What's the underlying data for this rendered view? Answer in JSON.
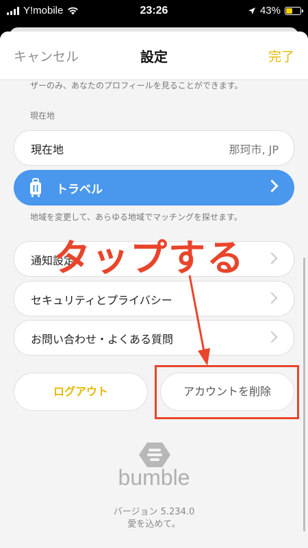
{
  "status_bar": {
    "carrier": "Y!mobile",
    "time": "23:26",
    "battery_percent": "43%",
    "battery_color": "#ffd400"
  },
  "nav": {
    "cancel": "キャンセル",
    "title": "設定",
    "done": "完了"
  },
  "profile_note": "ザーのみ、あなたのプロフィールを見ることができます。",
  "location_section": {
    "label": "現在地",
    "row_label": "現在地",
    "row_value": "那珂市, JP"
  },
  "travel": {
    "label": "トラベル",
    "icon": "suitcase-icon",
    "color": "#4a97ee",
    "note": "地域を変更して、あらゆる地域でマッチングを探せます。"
  },
  "settings_rows": [
    {
      "label": "通知設定"
    },
    {
      "label": "セキュリティとプライバシー"
    },
    {
      "label": "お問い合わせ・よくある質問"
    }
  ],
  "buttons": {
    "logout": "ログアウト",
    "delete_account": "アカウントを削除"
  },
  "annotation": {
    "text": "タップする",
    "color": "#e8452b"
  },
  "footer": {
    "brand": "bumble",
    "version": "バージョン 5.234.0",
    "tagline": "愛を込めて。"
  }
}
